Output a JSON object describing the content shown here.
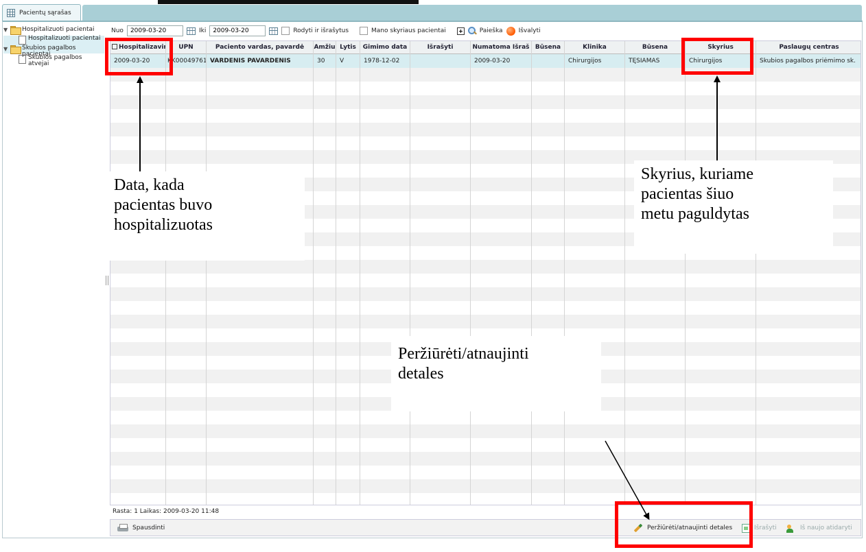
{
  "tab": {
    "label": "Pacientų sąrašas"
  },
  "tree": {
    "items": [
      {
        "label": "Hospitalizuoti pacientai"
      },
      {
        "label": "Hospitalizuoti pacientai"
      },
      {
        "label": "Skubios pagalbos pacientai"
      },
      {
        "label": "Skubios pagalbos atvejai"
      }
    ]
  },
  "filters": {
    "from_label": "Nuo",
    "from_value": "2009-03-20",
    "to_label": "Iki",
    "to_value": "2009-03-20",
    "show_discharged_label": "Rodyti ir išrašytus",
    "my_department_label": "Mano skyriaus pacientai",
    "search_label": "Paieška",
    "clear_label": "Išvalyti"
  },
  "table": {
    "columns": [
      "Hospitalizavim",
      "UPN",
      "Paciento vardas, pavardė",
      "Amžiu",
      "Lytis",
      "Gimimo data",
      "Išrašyti",
      "Numatoma Išraš",
      "Būsena",
      "Klinika",
      "Būsena",
      "Skyrius",
      "Paslaugų centras"
    ],
    "rows": [
      [
        "2009-03-20",
        "KK00049761",
        "VARDENIS PAVARDENIS",
        "30",
        "V",
        "1978-12-02",
        "",
        "2009-03-20",
        "",
        "Chirurgijos",
        "TĘSIAMAS",
        "Chirurgijos",
        "Skubios pagalbos priėmimo sk."
      ]
    ]
  },
  "status": {
    "text": "Rasta: 1  Laikas: 2009-03-20 11:48"
  },
  "footer": {
    "print_label": "Spausdinti",
    "view_update_label": "Peržiūrėti/atnaujinti detales",
    "discharge_label": "Išrašyti",
    "reopen_label": "Iš naujo atidaryti"
  },
  "annotations": {
    "date_callout": [
      "Data, kada",
      "pacientas buvo",
      "hospitalizuotas"
    ],
    "department_callout": [
      "Skyrius, kuriame",
      "pacientas šiuo",
      "metu paguldytas"
    ],
    "details_callout": [
      "Peržiūrėti/atnaujinti",
      "detales"
    ],
    "highlight_color": "#ff0000"
  }
}
